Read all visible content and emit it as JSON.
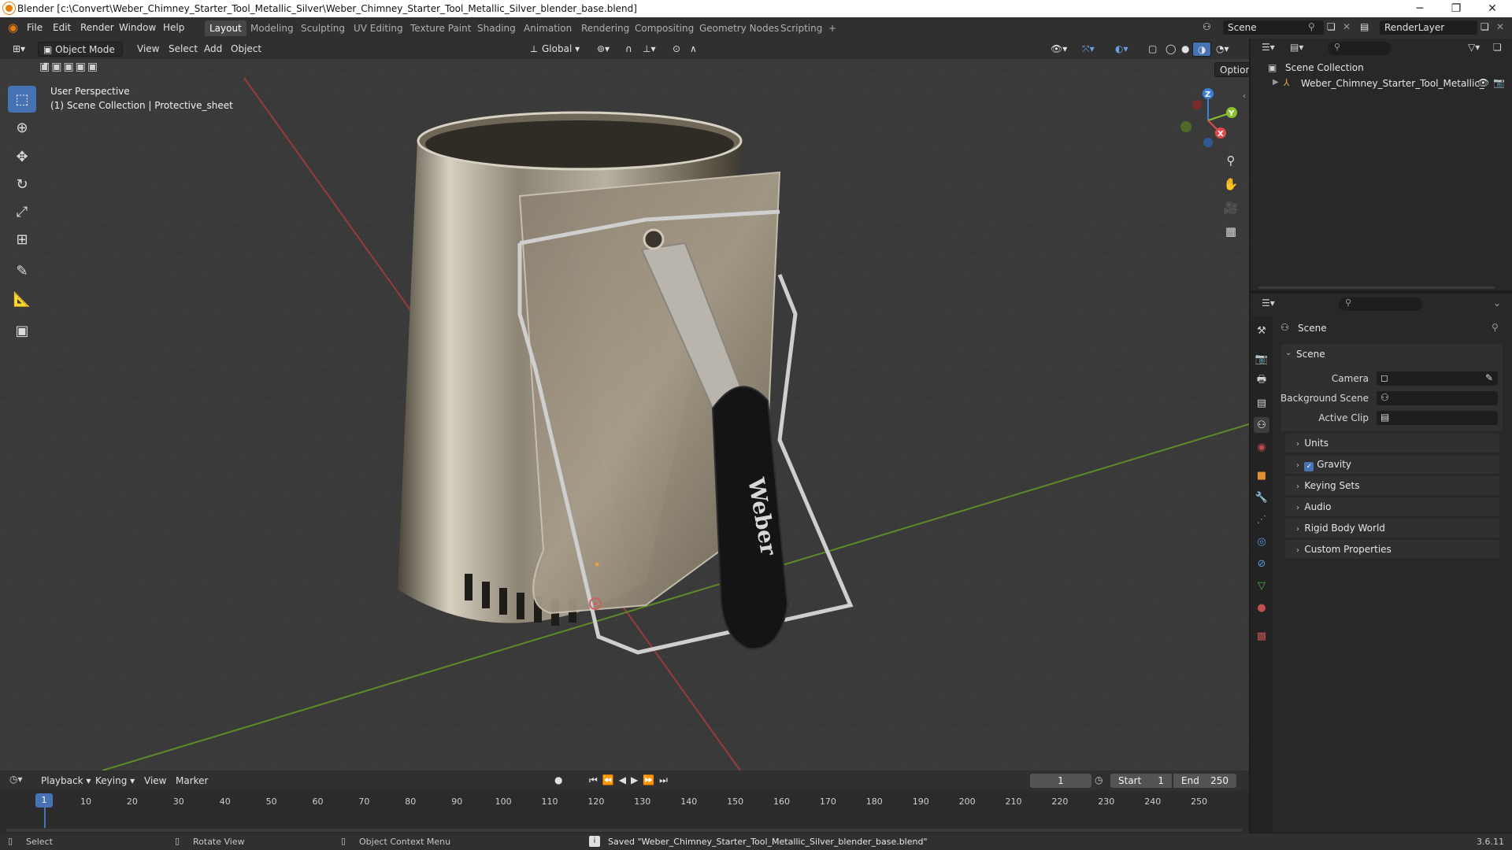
{
  "window": {
    "title": "Blender [c:\\Convert\\Weber_Chimney_Starter_Tool_Metallic_Silver\\Weber_Chimney_Starter_Tool_Metallic_Silver_blender_base.blend]",
    "minimize": "─",
    "maximize": "❐",
    "close": "✕"
  },
  "menu": [
    "File",
    "Edit",
    "Render",
    "Window",
    "Help"
  ],
  "workspaces": [
    "Layout",
    "Modeling",
    "Sculpting",
    "UV Editing",
    "Texture Paint",
    "Shading",
    "Animation",
    "Rendering",
    "Compositing",
    "Geometry Nodes",
    "Scripting",
    "+"
  ],
  "active_workspace": "Layout",
  "scene_selector": "Scene",
  "renderlayer_selector": "RenderLayer",
  "viewport_header": {
    "mode": "Object Mode",
    "menus": [
      "View",
      "Select",
      "Add",
      "Object"
    ],
    "orientation": "Global",
    "options": "Options"
  },
  "viewport_overlay": {
    "perspective": "User Perspective",
    "collection_info": "(1) Scene Collection | Protective_sheet"
  },
  "gizmo": {
    "x": "X",
    "y": "Y",
    "z": "Z"
  },
  "product_logo": "Weber",
  "outliner": {
    "root": "Scene Collection",
    "items": [
      "Weber_Chimney_Starter_Tool_Metallic_"
    ]
  },
  "properties": {
    "header": "Scene",
    "panel_title": "Scene",
    "fields": [
      {
        "label": "Camera"
      },
      {
        "label": "Background Scene"
      },
      {
        "label": "Active Clip"
      }
    ],
    "panels": [
      "Units",
      "Gravity",
      "Keying Sets",
      "Audio",
      "Rigid Body World",
      "Custom Properties"
    ],
    "gravity_checked": true
  },
  "timeline": {
    "menus": [
      "Playback",
      "Keying",
      "View",
      "Marker"
    ],
    "current_frame": "1",
    "start_label": "Start",
    "start": "1",
    "end_label": "End",
    "end": "250",
    "ticks": [
      "1",
      "10",
      "20",
      "30",
      "40",
      "50",
      "60",
      "70",
      "80",
      "90",
      "100",
      "110",
      "120",
      "130",
      "140",
      "150",
      "160",
      "170",
      "180",
      "190",
      "200",
      "210",
      "220",
      "230",
      "240",
      "250"
    ]
  },
  "status": {
    "select": "Select",
    "rotate": "Rotate View",
    "context": "Object Context Menu",
    "message": "Saved \"Weber_Chimney_Starter_Tool_Metallic_Silver_blender_base.blend\"",
    "version": "3.6.11"
  },
  "colors": {
    "accent": "#4772b3",
    "x_axis": "#e04a4a",
    "y_axis": "#8bbf2e",
    "z_axis": "#3c7fd8"
  }
}
